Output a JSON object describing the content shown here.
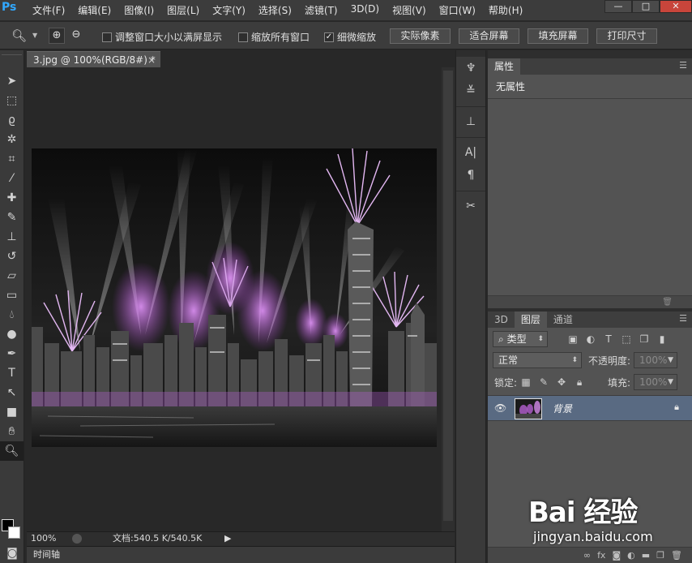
{
  "app": {
    "logo": "Ps"
  },
  "menu": [
    "文件(F)",
    "编辑(E)",
    "图像(I)",
    "图层(L)",
    "文字(Y)",
    "选择(S)",
    "滤镜(T)",
    "3D(D)",
    "视图(V)",
    "窗口(W)",
    "帮助(H)"
  ],
  "window_buttons": {
    "minimize": "—",
    "restore": "□",
    "close": "✕"
  },
  "options": {
    "tool_icon": "zoom-tool-icon",
    "resize_windows_label": "调整窗口大小以满屏显示",
    "resize_windows_checked": false,
    "zoom_all_label": "缩放所有窗口",
    "zoom_all_checked": false,
    "scrubby_label": "细微缩放",
    "scrubby_checked": true,
    "actual_pixels": "实际像素",
    "fit_screen": "适合屏幕",
    "fill_screen": "填充屏幕",
    "print_size": "打印尺寸"
  },
  "document": {
    "tab_title": "3.jpg @ 100%(RGB/8#) *",
    "close": "×"
  },
  "status": {
    "zoom": "100%",
    "doc_info": "文档:540.5 K/540.5K"
  },
  "timeline": {
    "label": "时间轴"
  },
  "properties": {
    "tab": "属性",
    "empty_text": "无属性"
  },
  "layers": {
    "tabs": [
      "3D",
      "图层",
      "通道"
    ],
    "active_tab": 1,
    "filter_kind": "类型",
    "blend_mode": "正常",
    "opacity_label": "不透明度:",
    "opacity_value": "100%",
    "lock_label": "锁定:",
    "fill_label": "填充:",
    "fill_value": "100%",
    "items": [
      {
        "name": "背景",
        "visible": true,
        "locked": true
      }
    ]
  },
  "watermark": {
    "logo": "Bai 经验",
    "url": "jingyan.baidu.com"
  },
  "colors": {
    "accent": "#31a8ff",
    "selected_layer": "#596a82",
    "firework": "#c86ee0"
  }
}
